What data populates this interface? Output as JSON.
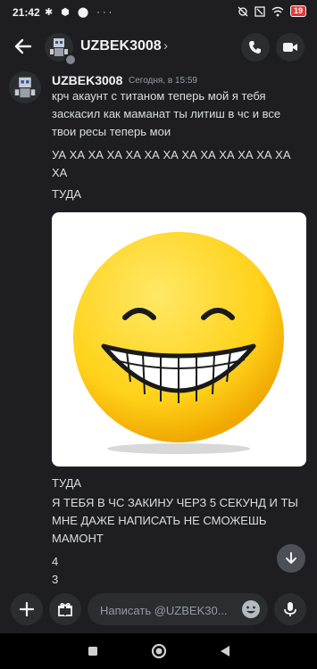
{
  "status_bar": {
    "time": "21:42",
    "battery": "19"
  },
  "header": {
    "title": "UZBEK3008",
    "chevron": "›"
  },
  "message": {
    "author": "UZBEK3008",
    "timestamp": "Сегодня, в 15:59",
    "text1": "крч акаунт с титаном теперь мой я тебя заскасил как маманат ты литиш в чс и все твои ресы теперь мои",
    "text2": "УА ХА ХА ХА ХА ХА ХА ХА ХА ХА ХА ХА ХА ХА",
    "text3": "ТУДА",
    "image": "smiley-emoji-image",
    "text4": "ТУДА",
    "text5": "Я ТЕБЯ В ЧС ЗАКИНУ ЧЕРЗ 5 СЕКУНД И ТЫ МНЕ ДАЖЕ НАПИСАТЬ НЕ СМОЖЕШЬ МАМОНТ",
    "text6": "4",
    "text7": "3"
  },
  "input": {
    "placeholder": "Написать @UZBEK30..."
  },
  "colors": {
    "background": "#1e1e22",
    "button": "#2b2d31",
    "smiley": "#ffd21a"
  }
}
